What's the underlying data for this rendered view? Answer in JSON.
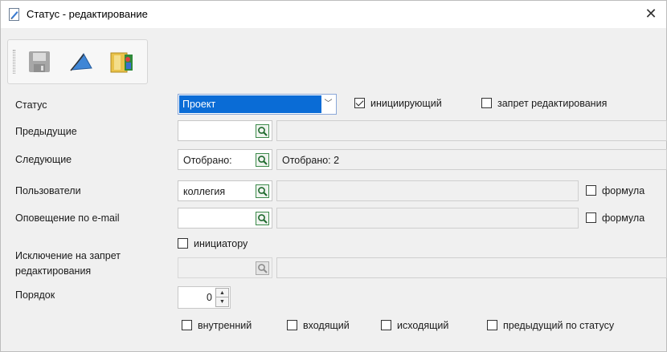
{
  "window": {
    "title": "Статус - редактирование",
    "close_glyph": "✕"
  },
  "toolbar": {
    "buttons": [
      "save-icon",
      "paint-bucket-icon",
      "map-exit-icon"
    ]
  },
  "form": {
    "status": {
      "label": "Статус",
      "value": "Проект",
      "arrow": "﹀"
    },
    "initiating": {
      "label": "инициирующий",
      "checked": true
    },
    "edit_ban": {
      "label": "запрет редактирования",
      "checked": false
    },
    "previous": {
      "label": "Предыдущие",
      "value": "",
      "detail": ""
    },
    "next": {
      "label": "Следующие",
      "value": "Отобрано:",
      "detail": "Отобрано: 2"
    },
    "users": {
      "label": "Пользователи",
      "value": "коллегия",
      "detail": "",
      "formula_label": "формула"
    },
    "email": {
      "label": "Оповещение по e-mail",
      "value": "",
      "detail": "",
      "formula_label": "формула"
    },
    "exclusion": {
      "label_line1": "Исключение на запрет",
      "label_line2": "редактирования",
      "initiator_label": "инициатору",
      "value": "",
      "detail": ""
    },
    "order": {
      "label": "Порядок",
      "value": "0"
    },
    "flags": {
      "internal": "внутренний",
      "incoming": "входящий",
      "outgoing": "исходящий",
      "prev_by_status": "предыдущий по статусу"
    }
  },
  "colors": {
    "selection": "#0a6cd6",
    "window_bg": "#f0f0f0"
  }
}
